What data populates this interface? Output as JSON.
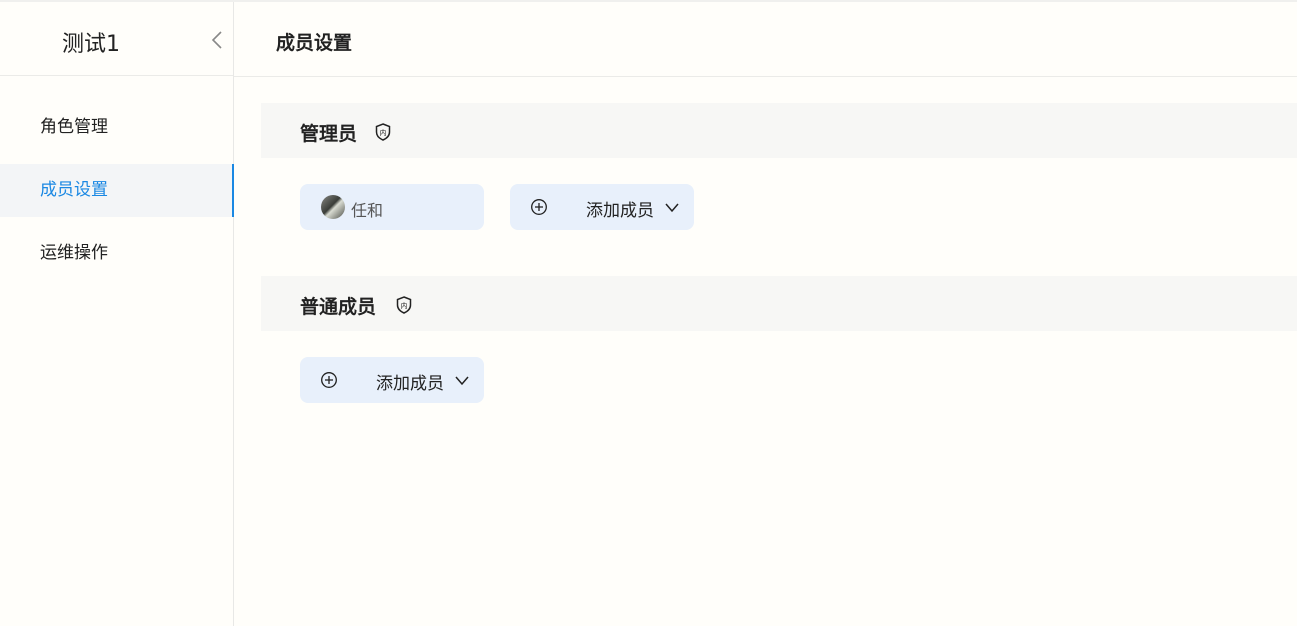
{
  "app": {
    "title": "测试1"
  },
  "sidebar": {
    "items": [
      {
        "label": "角色管理",
        "active": false
      },
      {
        "label": "成员设置",
        "active": true
      },
      {
        "label": "运维操作",
        "active": false
      }
    ]
  },
  "main": {
    "page_title": "成员设置",
    "sections": [
      {
        "title": "管理员",
        "badge_icon": "shield-nei-icon",
        "members": [
          {
            "name": "任和",
            "avatar": "avatar-photo"
          }
        ],
        "add_label": "添加成员"
      },
      {
        "title": "普通成员",
        "badge_icon": "shield-nei-icon",
        "members": [],
        "add_label": "添加成员"
      }
    ]
  },
  "colors": {
    "accent": "#1a88e3",
    "chip_bg": "#e8f0fb",
    "section_bg": "#f7f7f5",
    "page_bg": "#fffefa"
  }
}
